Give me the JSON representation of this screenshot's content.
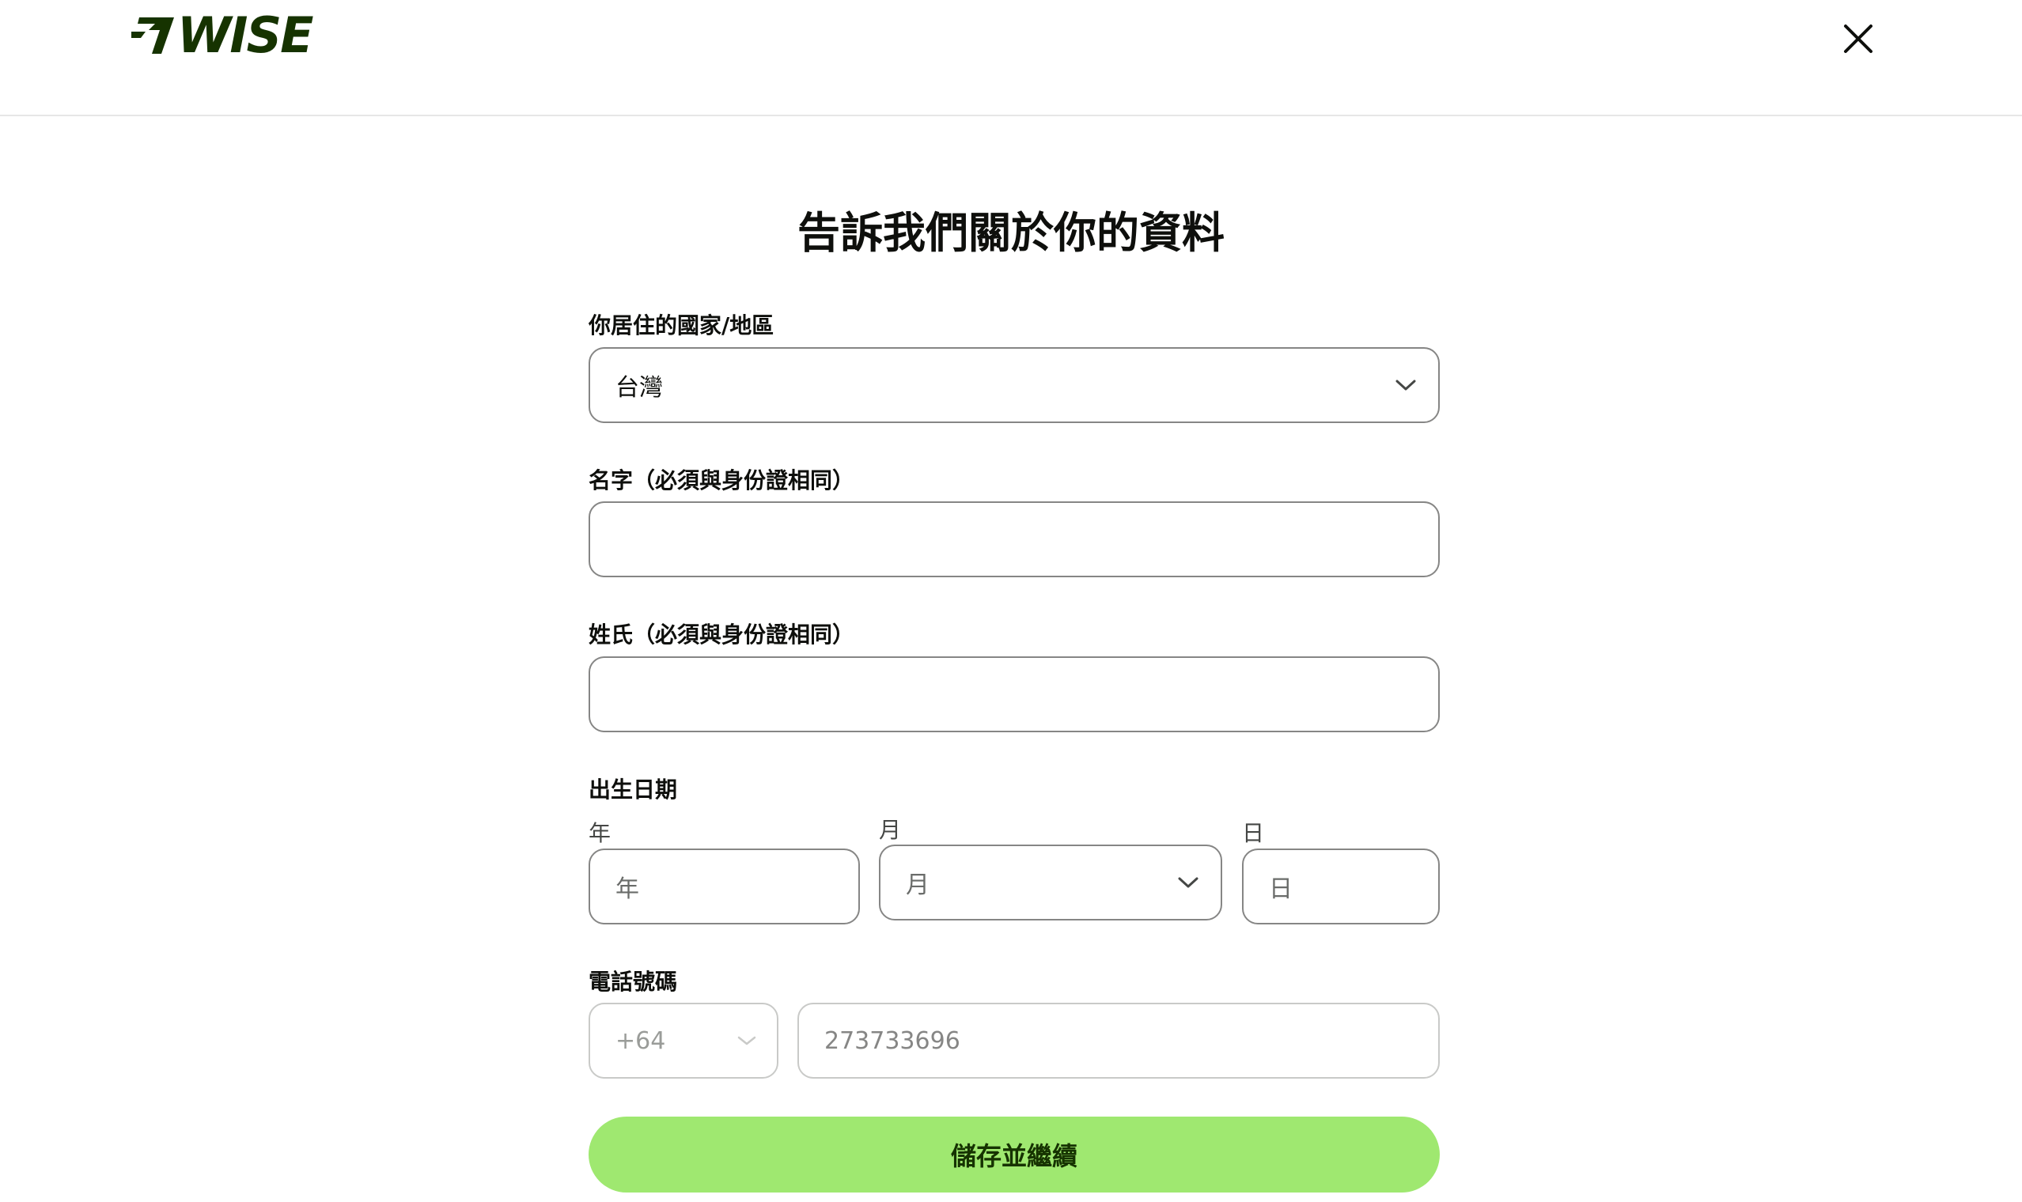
{
  "brand": {
    "name": "WISE"
  },
  "title": "告訴我們關於你的資料",
  "country": {
    "label": "你居住的國家/地區",
    "value": "台灣"
  },
  "first_name": {
    "label": "名字（必須與身份證相同）",
    "value": ""
  },
  "last_name": {
    "label": "姓氏（必須與身份證相同）",
    "value": ""
  },
  "dob": {
    "label": "出生日期",
    "year": {
      "label": "年",
      "placeholder": "年"
    },
    "month": {
      "label": "月",
      "placeholder": "月"
    },
    "day": {
      "label": "日",
      "placeholder": "日"
    }
  },
  "phone": {
    "label": "電話號碼",
    "country_code": "+64",
    "number_placeholder": "273733696"
  },
  "submit_label": "儲存並繼續",
  "colors": {
    "brand": "#163300",
    "accent": "#9fe870"
  }
}
